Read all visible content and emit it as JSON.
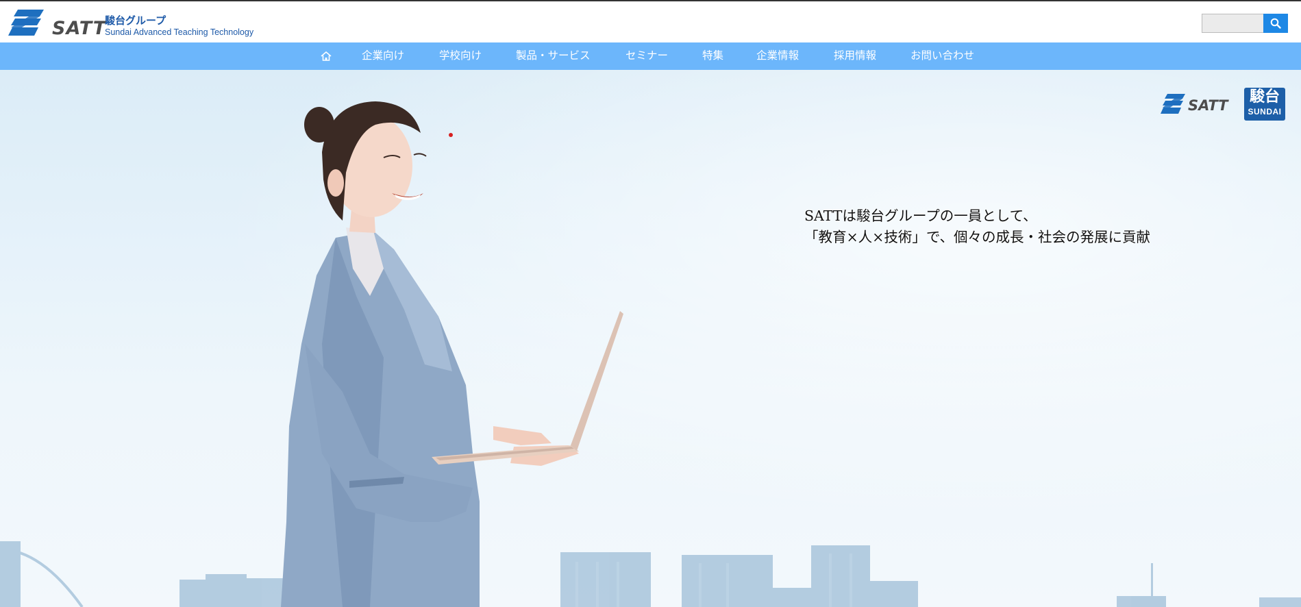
{
  "header": {
    "logo_text": "SATT",
    "group_name": "駿台グループ",
    "group_name_en": "Sundai Advanced Teaching Technology",
    "search": {
      "placeholder": "",
      "button_icon": "search-icon"
    }
  },
  "nav": {
    "home_icon": "home-icon",
    "items": [
      {
        "label": "企業向け"
      },
      {
        "label": "学校向け"
      },
      {
        "label": "製品・サービス"
      },
      {
        "label": "セミナー"
      },
      {
        "label": "特集"
      },
      {
        "label": "企業情報"
      },
      {
        "label": "採用情報"
      },
      {
        "label": "お問い合わせ"
      }
    ]
  },
  "hero": {
    "logo_satt": "SATT",
    "sundai_kanji": "駿台",
    "sundai_en": "SUNDAI",
    "tagline_line1": "SATTは駿台グループの一員として、",
    "tagline_line2": "「教育×人×技術」で、個々の成長・社会の発展に貢献"
  },
  "colors": {
    "nav_bg": "#6cb6fb",
    "brand_blue": "#1e5aa8",
    "search_button": "#1e88e5",
    "sundai_badge": "#1d5fa8"
  }
}
